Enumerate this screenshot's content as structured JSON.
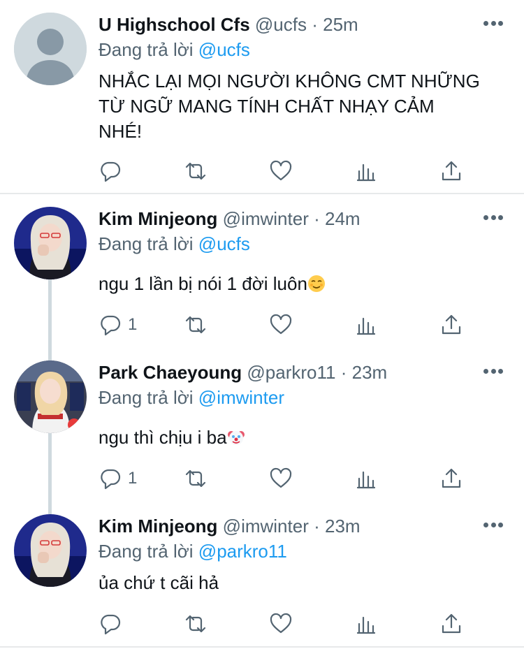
{
  "tweets": [
    {
      "name": "U Highschool Cfs",
      "handle": "@ucfs",
      "time": "25m",
      "reply_prefix": "Đang trả lời",
      "reply_to": "@ucfs",
      "text_lines": [
        "NHẮC LẠI MỌI NGƯỜI KHÔNG CMT NHỮNG",
        "TỪ NGỮ MANG TÍNH CHẤT NHẠY CẢM",
        "NHÉ!"
      ],
      "reply_count": ""
    },
    {
      "name": "Kim Minjeong",
      "handle": "@imwinter",
      "time": "24m",
      "reply_prefix": "Đang trả lời",
      "reply_to": "@ucfs",
      "text": "ngu 1 lần bị nói 1 đời luôn",
      "emoji": "relieved-face",
      "reply_count": "1"
    },
    {
      "name": "Park Chaeyoung",
      "handle": "@parkro11",
      "time": "23m",
      "reply_prefix": "Đang trả lời",
      "reply_to": "@imwinter",
      "text": "ngu thì chịu i ba",
      "emoji": "clown-face",
      "reply_count": "1"
    },
    {
      "name": "Kim Minjeong",
      "handle": "@imwinter",
      "time": "23m",
      "reply_prefix": "Đang trả lời",
      "reply_to": "@parkro11",
      "text": "ủa chứ t cãi hả",
      "reply_count": ""
    }
  ],
  "separator": "·",
  "icons": [
    "reply-icon",
    "retweet-icon",
    "like-icon",
    "analytics-icon",
    "share-icon",
    "more-icon"
  ],
  "colors": {
    "link": "#1d9bf0",
    "secondary": "#536471",
    "text": "#0f1419",
    "divider": "#e7e9ea"
  }
}
